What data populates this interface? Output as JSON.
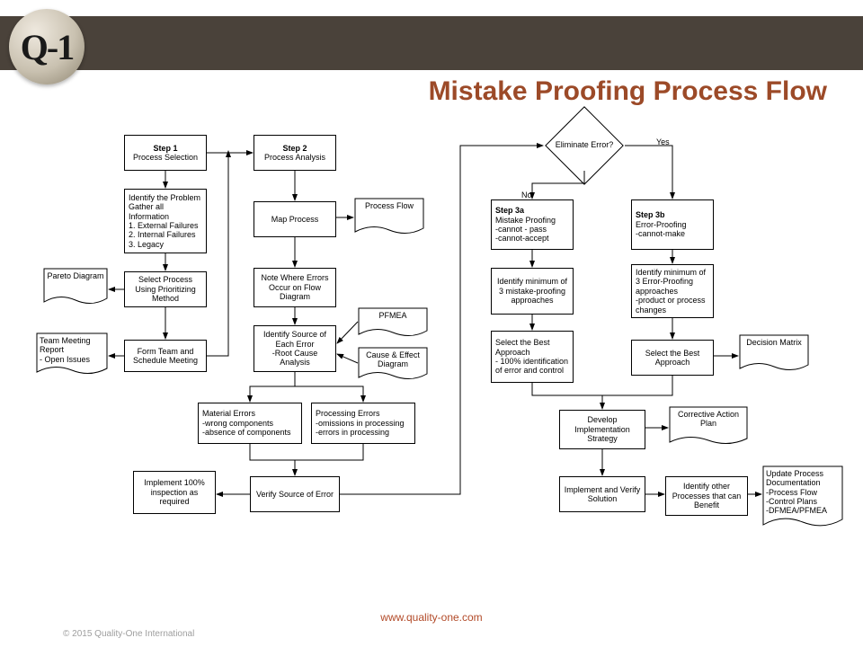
{
  "header": {
    "logo_text": "Q-1",
    "title": "Mistake Proofing Process Flow"
  },
  "footer": {
    "url": "www.quality-one.com",
    "copyright": "© 2015 Quality-One International"
  },
  "diagram": {
    "decision": {
      "label": "Eliminate Error?",
      "yes": "Yes",
      "no": "No"
    },
    "boxes": {
      "step1": {
        "title": "Step 1",
        "sub": "Process Selection"
      },
      "step2": {
        "title": "Step 2",
        "sub": "Process Analysis"
      },
      "step3a": {
        "title": "Step 3a",
        "l1": "Mistake Proofing",
        "l2": "-cannot - pass",
        "l3": "-cannot-accept"
      },
      "step3b": {
        "title": "Step 3b",
        "l1": "Error-Proofing",
        "l2": "-cannot-make"
      },
      "identify_problem": {
        "l1": "Identify the Problem",
        "l2": "Gather all Information",
        "l3": "1. External Failures",
        "l4": "2. Internal Failures",
        "l5": "3. Legacy"
      },
      "select_process": {
        "text": "Select Process Using Prioritizing Method"
      },
      "form_team": {
        "text": "Form Team and Schedule Meeting"
      },
      "map_process": {
        "text": "Map Process"
      },
      "note_errors": {
        "text": "Note Where Errors Occur on Flow Diagram"
      },
      "identify_source": {
        "l1": "Identify Source of Each Error",
        "l2": "-Root Cause Analysis"
      },
      "material_errors": {
        "l1": "Material Errors",
        "l2": "-wrong components",
        "l3": "-absence of components"
      },
      "processing_errors": {
        "l1": "Processing Errors",
        "l2": "-omissions in processing",
        "l3": "-errors in processing"
      },
      "verify_source": {
        "text": "Verify Source of Error"
      },
      "implement_inspection": {
        "text": "Implement 100% inspection as required"
      },
      "identify_min_3a": {
        "text": "Identify minimum of 3 mistake-proofing approaches"
      },
      "identify_min_3b": {
        "l1": "Identify minimum of 3 Error-Proofing approaches",
        "l2": "-product or process changes"
      },
      "select_best_3a": {
        "l1": "Select the Best Approach",
        "l2": "- 100% identification of error and control"
      },
      "select_best_3b": {
        "text": "Select the Best Approach"
      },
      "develop_strategy": {
        "text": "Develop Implementation Strategy"
      },
      "implement_verify": {
        "text": "Implement and Verify Solution"
      },
      "identify_other": {
        "text": "Identify other Processes that can Benefit"
      }
    },
    "docs": {
      "pareto": {
        "text": "Pareto Diagram"
      },
      "team_report": {
        "l1": "Team Meeting Report",
        "l2": "- Open Issues"
      },
      "process_flow": {
        "text": "Process Flow"
      },
      "pfmea": {
        "text": "PFMEA"
      },
      "cause_effect": {
        "text": "Cause & Effect Diagram"
      },
      "decision_matrix": {
        "text": "Decision Matrix"
      },
      "corrective_action": {
        "text": "Corrective Action Plan"
      },
      "update_docs": {
        "l1": "Update Process Documentation",
        "l2": "-Process Flow",
        "l3": "-Control Plans",
        "l4": "-DFMEA/PFMEA"
      }
    }
  }
}
